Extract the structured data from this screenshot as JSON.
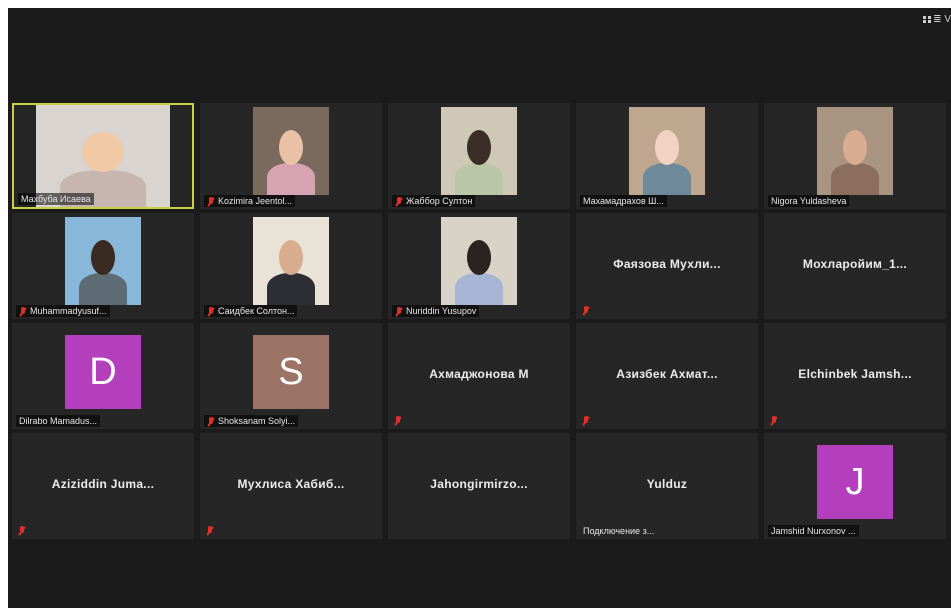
{
  "toolbar": {
    "view_label": "≣ V"
  },
  "participants": [
    {
      "name": "Махбуба Исаева",
      "type": "video",
      "active": true,
      "muted": false
    },
    {
      "name": "Kozimira Jeentol...",
      "type": "video",
      "muted": true
    },
    {
      "name": "Жаббор Султон",
      "type": "video",
      "muted": true
    },
    {
      "name": "Махамадрахов Ш...",
      "type": "video",
      "muted": false
    },
    {
      "name": "Nigora Yuldasheva",
      "type": "video",
      "muted": false
    },
    {
      "name": "Muhammadyusuf...",
      "type": "video",
      "muted": true
    },
    {
      "name": "Саидбек Солтон...",
      "type": "video",
      "muted": true
    },
    {
      "name": "Nuriddin Yusupov",
      "type": "video",
      "muted": true
    },
    {
      "name": "Фаязова Мухли...",
      "type": "name",
      "muted": true
    },
    {
      "name": "Мохларойим_1...",
      "type": "name",
      "muted": false
    },
    {
      "name": "Dilrabo Mamadus...",
      "type": "avatar",
      "initial": "D",
      "color": "#b33fbd",
      "muted": false
    },
    {
      "name": "Shoksanam Solyi...",
      "type": "avatar",
      "initial": "S",
      "color": "#9b7465",
      "muted": true
    },
    {
      "name": "Ахмаджонова М",
      "type": "name",
      "muted": true
    },
    {
      "name": "Азизбек Ахмат...",
      "type": "name",
      "muted": true
    },
    {
      "name": "Elchinbek Jamsh...",
      "type": "name",
      "muted": true
    },
    {
      "name": "Aziziddin Juma...",
      "type": "name",
      "muted": true
    },
    {
      "name": "Мухлиса Хабиб...",
      "type": "name",
      "muted": true
    },
    {
      "name": "Jahongirmirzo...",
      "type": "name",
      "muted": false
    },
    {
      "name": "Yulduz",
      "type": "name",
      "status": "Подключение з...",
      "muted": false
    },
    {
      "name": "Jamshid Nurxonov ...",
      "type": "avatar",
      "initial": "J",
      "color": "#b33fbd",
      "muted": false
    }
  ],
  "video_colors": [
    [
      "#d9d4cf",
      "#f2c9a6",
      "#c7b6b0"
    ],
    [
      "#7a6a5e",
      "#e9c1a6",
      "#d7a3b2"
    ],
    [
      "#cfc8b6",
      "#3b2d28",
      "#b9c6a8"
    ],
    [
      "#bfa78f",
      "#f1d3c1",
      "#6e8a9a"
    ],
    [
      "#a99482",
      "#d8ad92",
      "#8b6e5d"
    ],
    [
      "#88b7d9",
      "#3a2b22",
      "#5d6b74"
    ],
    [
      "#e9e2d7",
      "#d7ac8f",
      "#2d2d34"
    ],
    [
      "#d9d2c7",
      "#2a2320",
      "#a6b5d4"
    ]
  ]
}
